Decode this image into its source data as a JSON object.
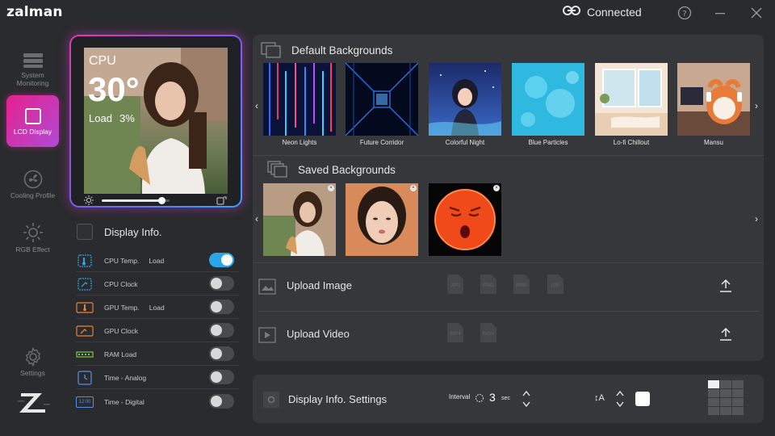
{
  "app": {
    "logo": "zalman",
    "connection_status": "Connected"
  },
  "sidebar": {
    "items": [
      {
        "label": "System Monitoring",
        "icon": "system-monitoring-icon"
      },
      {
        "label": "LCD Display",
        "icon": "lcd-display-icon",
        "active": true
      },
      {
        "label": "Cooling Profile",
        "icon": "fan-icon"
      },
      {
        "label": "RGB Effect",
        "icon": "sun-icon"
      },
      {
        "label": "Settings",
        "icon": "gear-icon"
      }
    ]
  },
  "preview": {
    "sensor": "CPU",
    "temperature": "30°",
    "load_label": "Load",
    "load_value": "3%",
    "brightness": 0.88
  },
  "display_info": {
    "title": "Display Info.",
    "rows": [
      {
        "label": "CPU Temp.",
        "sub": "Load",
        "on": true,
        "icon": "cpu-temp-icon"
      },
      {
        "label": "CPU Clock",
        "sub": "",
        "on": false,
        "icon": "cpu-clock-icon"
      },
      {
        "label": "GPU Temp.",
        "sub": "Load",
        "on": false,
        "icon": "gpu-temp-icon"
      },
      {
        "label": "GPU Clock",
        "sub": "",
        "on": false,
        "icon": "gpu-clock-icon"
      },
      {
        "label": "RAM Load",
        "sub": "",
        "on": false,
        "icon": "ram-icon"
      },
      {
        "label": "Time - Analog",
        "sub": "",
        "on": false,
        "icon": "analog-clock-icon"
      },
      {
        "label": "Time - Digital",
        "sub": "",
        "on": false,
        "icon": "digital-clock-icon",
        "icon_text": "12:00"
      }
    ]
  },
  "default_backgrounds": {
    "title": "Default Backgrounds",
    "items": [
      "Neon Lights",
      "Future Corridor",
      "Colorful Night",
      "Blue Particles",
      "Lo-fi Chillout",
      "Mansu"
    ]
  },
  "saved_backgrounds": {
    "title": "Saved Backgrounds"
  },
  "upload_image": {
    "label": "Upload Image",
    "formats": [
      "JPG",
      "PNG",
      "BMP",
      "GIF"
    ]
  },
  "upload_video": {
    "label": "Upload Video",
    "formats": [
      "MP4",
      "MOV"
    ]
  },
  "display_settings": {
    "title": "Display Info. Settings",
    "interval_label": "Interval",
    "interval_value": "3",
    "interval_unit": "sec",
    "font_icon_text": "A"
  }
}
